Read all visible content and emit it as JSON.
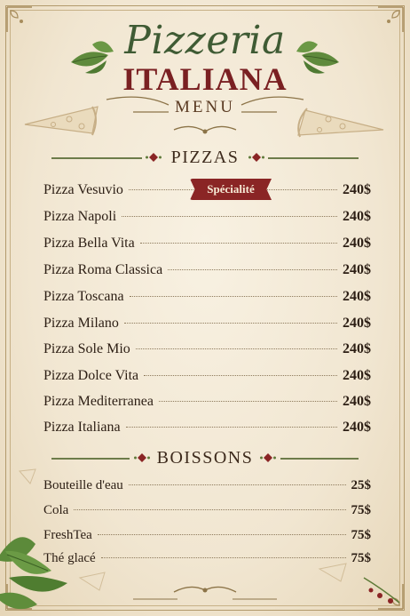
{
  "header": {
    "title_line1": "Pizzeria",
    "title_line2": "ITALIANA",
    "subtitle": "MENU"
  },
  "sections": {
    "pizzas": {
      "title": "PIZZAS",
      "badge": "Spécialité",
      "items": [
        {
          "name": "Pizza Vesuvio",
          "price": "240$"
        },
        {
          "name": "Pizza Napoli",
          "price": "240$"
        },
        {
          "name": "Pizza Bella Vita",
          "price": "240$"
        },
        {
          "name": "Pizza Roma Classica",
          "price": "240$"
        },
        {
          "name": "Pizza Toscana",
          "price": "240$"
        },
        {
          "name": "Pizza Milano",
          "price": "240$"
        },
        {
          "name": "Pizza Sole Mio",
          "price": "240$"
        },
        {
          "name": "Pizza Dolce Vita",
          "price": "240$"
        },
        {
          "name": "Pizza Mediterranea",
          "price": "240$"
        },
        {
          "name": "Pizza Italiana",
          "price": "240$"
        }
      ]
    },
    "boissons": {
      "title": "BOISSONS",
      "items": [
        {
          "name": "Bouteille d'eau",
          "price": "25$"
        },
        {
          "name": "Cola",
          "price": "75$"
        },
        {
          "name": "FreshTea",
          "price": "75$"
        },
        {
          "name": "Thé glacé",
          "price": "75$"
        }
      ]
    }
  },
  "colors": {
    "title_green": "#3f5b34",
    "title_red": "#7a2022",
    "badge_red": "#8a2525",
    "paper": "#f1e6d1"
  }
}
